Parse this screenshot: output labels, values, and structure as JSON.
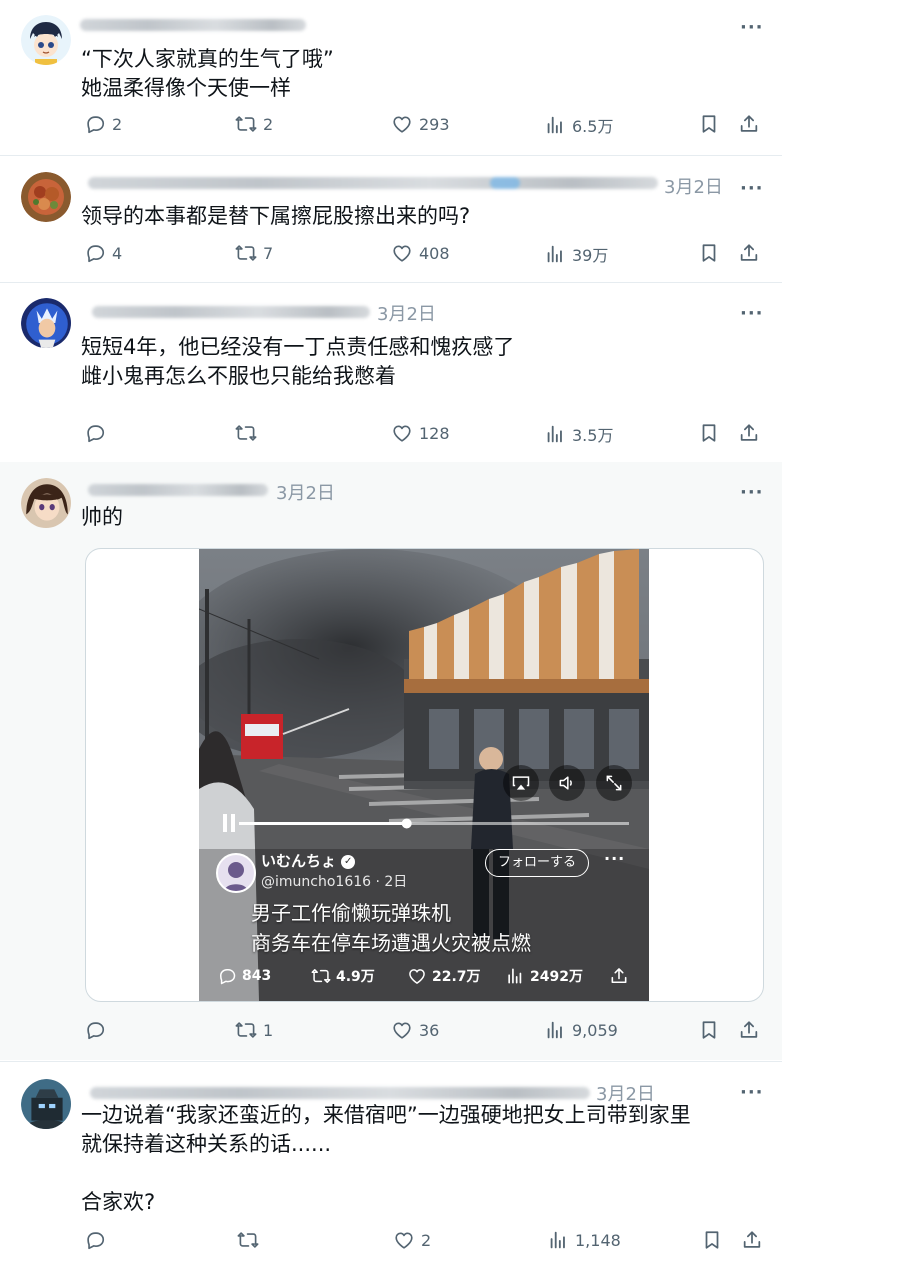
{
  "posts": [
    {
      "text": "“下次人家就真的生气了哦”\n她温柔得像个天使一样",
      "date": "",
      "stats": {
        "replies": "2",
        "reposts": "2",
        "likes": "293",
        "views": "6.5万"
      }
    },
    {
      "text": "领导的本事都是替下属擦屁股擦出来的吗?",
      "date": "3月2日",
      "stats": {
        "replies": "4",
        "reposts": "7",
        "likes": "408",
        "views": "39万"
      }
    },
    {
      "text": "短短4年，他已经没有一丁点责任感和愧疚感了\n雌小鬼再怎么不服也只能给我憋着",
      "date": "3月2日",
      "stats": {
        "replies": "",
        "reposts": "",
        "likes": "128",
        "views": "3.5万"
      }
    },
    {
      "text": "帅的",
      "date": "3月2日",
      "stats": {
        "replies": "",
        "reposts": "1",
        "likes": "36",
        "views": "9,059"
      }
    },
    {
      "text": "一边说着“我家还蛮近的，来借宿吧”一边强硬地把女上司带到家里\n就保持着这种关系的话......\n\n合家欢?",
      "date": "3月2日",
      "stats": {
        "replies": "",
        "reposts": "",
        "likes": "2",
        "views": "1,148"
      }
    }
  ],
  "video": {
    "account_name": "いむんちょ",
    "handle": "@imuncho1616 · 2日",
    "follow_label": "フォローする",
    "caption_line1": "男子工作偷懒玩弹珠机",
    "caption_line2": "商务车在停车场遭遇火灾被点燃",
    "stats": {
      "replies": "843",
      "reposts": "4.9万",
      "likes": "22.7万",
      "views": "2492万"
    },
    "progress": 0.43
  },
  "icons": {
    "reply": "reply-icon",
    "repost": "repost-icon",
    "like": "like-icon",
    "views": "views-icon",
    "bookmark": "bookmark-icon",
    "share": "share-icon",
    "more": "more-icon",
    "pause": "pause-icon",
    "airplay": "airplay-icon",
    "volume": "volume-icon",
    "exit": "exit-fullscreen-icon",
    "verified": "verified-badge-icon"
  },
  "colors": {
    "text": "#0f1419",
    "secondary": "#536471",
    "border": "#cfd9de",
    "verified": "#1d9bf0"
  }
}
